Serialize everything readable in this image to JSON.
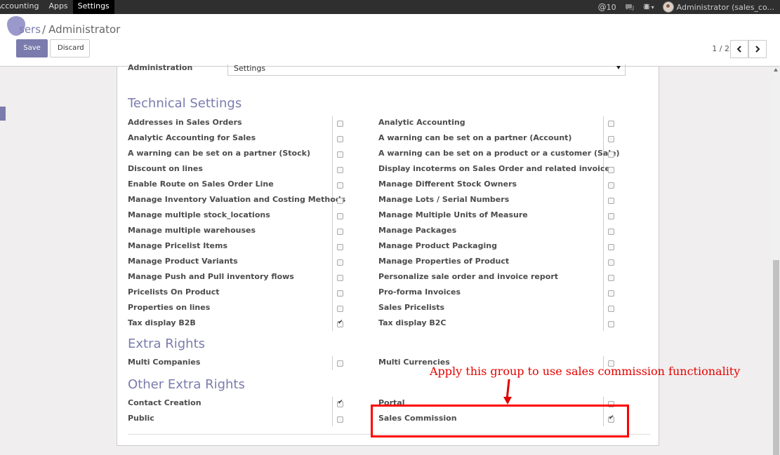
{
  "navbar": {
    "items": [
      {
        "label": "Accounting",
        "active": false
      },
      {
        "label": "Apps",
        "active": false
      },
      {
        "label": "Settings",
        "active": true
      }
    ],
    "messages_count": "10",
    "user_label": "Administrator (sales_co..."
  },
  "breadcrumb": {
    "parent": "Users",
    "parent_visible": "sers",
    "separator": "/",
    "current": "Administrator"
  },
  "buttons": {
    "save": "Save",
    "discard": "Discard"
  },
  "pager": {
    "text": "1 / 2"
  },
  "administration": {
    "label": "Administration",
    "value": "Settings"
  },
  "sections": [
    {
      "title": "Technical Settings",
      "rows": [
        {
          "left": "Addresses in Sales Orders",
          "left_checked": false,
          "right": "Analytic Accounting",
          "right_checked": false
        },
        {
          "left": "Analytic Accounting for Sales",
          "left_checked": false,
          "right": "A warning can be set on a partner (Account)",
          "right_checked": false
        },
        {
          "left": "A warning can be set on a partner (Stock)",
          "left_checked": false,
          "right": "A warning can be set on a product or a customer (Sale)",
          "right_checked": false
        },
        {
          "left": "Discount on lines",
          "left_checked": false,
          "right": "Display incoterms on Sales Order and related invoices",
          "right_checked": false
        },
        {
          "left": "Enable Route on Sales Order Line",
          "left_checked": false,
          "right": "Manage Different Stock Owners",
          "right_checked": false
        },
        {
          "left": "Manage Inventory Valuation and Costing Methods",
          "left_checked": false,
          "right": "Manage Lots / Serial Numbers",
          "right_checked": false
        },
        {
          "left": "Manage multiple stock_locations",
          "left_checked": false,
          "right": "Manage Multiple Units of Measure",
          "right_checked": false
        },
        {
          "left": "Manage multiple warehouses",
          "left_checked": false,
          "right": "Manage Packages",
          "right_checked": false
        },
        {
          "left": "Manage Pricelist Items",
          "left_checked": false,
          "right": "Manage Product Packaging",
          "right_checked": false
        },
        {
          "left": "Manage Product Variants",
          "left_checked": false,
          "right": "Manage Properties of Product",
          "right_checked": false
        },
        {
          "left": "Manage Push and Pull inventory flows",
          "left_checked": false,
          "right": "Personalize sale order and invoice report",
          "right_checked": false
        },
        {
          "left": "Pricelists On Product",
          "left_checked": false,
          "right": "Pro-forma Invoices",
          "right_checked": false
        },
        {
          "left": "Properties on lines",
          "left_checked": false,
          "right": "Sales Pricelists",
          "right_checked": false
        },
        {
          "left": "Tax display B2B",
          "left_checked": true,
          "right": "Tax display B2C",
          "right_checked": false
        }
      ]
    },
    {
      "title": "Extra Rights",
      "rows": [
        {
          "left": "Multi Companies",
          "left_checked": false,
          "right": "Multi Currencies",
          "right_checked": false
        }
      ]
    },
    {
      "title": "Other Extra Rights",
      "rows": [
        {
          "left": "Contact Creation",
          "left_checked": true,
          "right": "Portal",
          "right_checked": false
        },
        {
          "left": "Public",
          "left_checked": false,
          "right": "Sales Commission",
          "right_checked": true
        }
      ]
    }
  ],
  "annotation": {
    "text": "Apply this group to use sales commission functionality",
    "color": "#e60000"
  },
  "colors": {
    "brand": "#7c7bad",
    "navbar": "#2f2f2f"
  }
}
